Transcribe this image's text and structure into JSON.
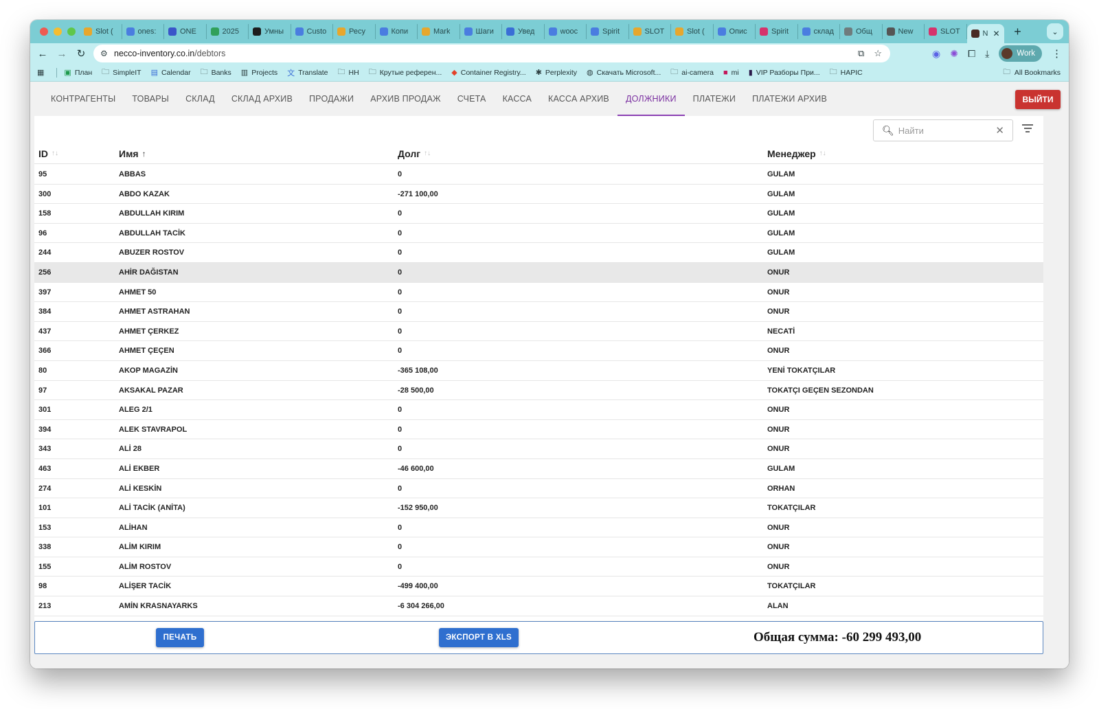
{
  "browser": {
    "tabs": [
      {
        "label": "Slot (",
        "color": "#e7a72d"
      },
      {
        "label": "ones:",
        "color": "#4a7de0"
      },
      {
        "label": "ONE",
        "color": "#3a55c9"
      },
      {
        "label": "2025",
        "color": "#31a05a"
      },
      {
        "label": "Умны",
        "color": "#1d1d1d"
      },
      {
        "label": "Custo",
        "color": "#4a7de0"
      },
      {
        "label": "Ресу",
        "color": "#e7a72d"
      },
      {
        "label": "Копи",
        "color": "#4a7de0"
      },
      {
        "label": "Mark",
        "color": "#e7a72d"
      },
      {
        "label": "Шаги",
        "color": "#4a7de0"
      },
      {
        "label": "Увед",
        "color": "#3a6ed6"
      },
      {
        "label": "wooc",
        "color": "#4a7de0"
      },
      {
        "label": "Spirit",
        "color": "#4a7de0"
      },
      {
        "label": "SLOT",
        "color": "#e7a72d"
      },
      {
        "label": "Slot (",
        "color": "#e7a72d"
      },
      {
        "label": "Опис",
        "color": "#4a7de0"
      },
      {
        "label": "Spirit",
        "color": "#d6336c"
      },
      {
        "label": "склад",
        "color": "#4a7de0"
      },
      {
        "label": "Общ",
        "color": "#6f7c7d"
      },
      {
        "label": "New",
        "color": "#555555"
      },
      {
        "label": "SLOT",
        "color": "#d6336c"
      }
    ],
    "active_tab": {
      "label": "N",
      "close": "✕"
    },
    "new_tab": "+",
    "url_host": "necco-inventory.co.in",
    "url_path": "/debtors",
    "profile": "Work",
    "bookmarks": [
      {
        "label": "План",
        "icon": "sheets-icon"
      },
      {
        "label": "SimpleIT",
        "icon": "folder-icon"
      },
      {
        "label": "Calendar",
        "icon": "calendar-icon"
      },
      {
        "label": "Banks",
        "icon": "folder-icon"
      },
      {
        "label": "Projects",
        "icon": "projects-icon"
      },
      {
        "label": "Translate",
        "icon": "translate-icon"
      },
      {
        "label": "HH",
        "icon": "folder-icon"
      },
      {
        "label": "Крутые референ...",
        "icon": "folder-icon"
      },
      {
        "label": "Container Registry...",
        "icon": "gitlab-icon"
      },
      {
        "label": "Perplexity",
        "icon": "perplexity-icon"
      },
      {
        "label": "Скачать Microsoft...",
        "icon": "download-icon"
      },
      {
        "label": "ai-camera",
        "icon": "folder-icon"
      },
      {
        "label": "mi",
        "icon": "mi-icon"
      },
      {
        "label": "VIP Разборы При...",
        "icon": "vip-icon"
      },
      {
        "label": "HAPIC",
        "icon": "folder-icon"
      }
    ],
    "all_bookmarks": "All Bookmarks"
  },
  "nav": {
    "items": [
      "КОНТРАГЕНТЫ",
      "ТОВАРЫ",
      "СКЛАД",
      "СКЛАД АРХИВ",
      "ПРОДАЖИ",
      "АРХИВ ПРОДАЖ",
      "СЧЕТА",
      "КАССА",
      "КАССА АРХИВ",
      "ДОЛЖНИКИ",
      "ПЛАТЕЖИ",
      "ПЛАТЕЖИ АРХИВ"
    ],
    "active_index": 9,
    "logout": "ВЫЙТИ"
  },
  "search": {
    "placeholder": "Найти"
  },
  "table": {
    "columns": [
      "ID",
      "Имя",
      "Долг",
      "Менеджер"
    ],
    "sorted_column": "Имя",
    "rows": [
      [
        "95",
        "ABBAS",
        "0",
        "GULAM"
      ],
      [
        "300",
        "ABDO KAZAK",
        "-271 100,00",
        "GULAM"
      ],
      [
        "158",
        "ABDULLAH KIRIM",
        "0",
        "GULAM"
      ],
      [
        "96",
        "ABDULLAH TACİK",
        "0",
        "GULAM"
      ],
      [
        "244",
        "ABUZER ROSTOV",
        "0",
        "GULAM"
      ],
      [
        "256",
        "AHİR DAĞISTAN",
        "0",
        "ONUR"
      ],
      [
        "397",
        "AHMET 50",
        "0",
        "ONUR"
      ],
      [
        "384",
        "AHMET ASTRAHAN",
        "0",
        "ONUR"
      ],
      [
        "437",
        "AHMET ÇERKEZ",
        "0",
        "NECATİ"
      ],
      [
        "366",
        "AHMET ÇEÇEN",
        "0",
        "ONUR"
      ],
      [
        "80",
        "AKOP MAGAZİN",
        "-365 108,00",
        "YENİ TOKATÇILAR"
      ],
      [
        "97",
        "AKSAKAL PAZAR",
        "-28 500,00",
        "TOKATÇI GEÇEN SEZONDAN"
      ],
      [
        "301",
        "ALEG 2/1",
        "0",
        "ONUR"
      ],
      [
        "394",
        "ALEK STAVRAPOL",
        "0",
        "ONUR"
      ],
      [
        "343",
        "ALİ 28",
        "0",
        "ONUR"
      ],
      [
        "463",
        "ALİ EKBER",
        "-46 600,00",
        "GULAM"
      ],
      [
        "274",
        "ALİ KESKİN",
        "0",
        "ORHAN"
      ],
      [
        "101",
        "ALİ TACİK (ANİTA)",
        "-152 950,00",
        "TOKATÇILAR"
      ],
      [
        "153",
        "ALİHAN",
        "0",
        "ONUR"
      ],
      [
        "338",
        "ALİM KIRIM",
        "0",
        "ONUR"
      ],
      [
        "155",
        "ALİM ROSTOV",
        "0",
        "ONUR"
      ],
      [
        "98",
        "ALİŞER TACİK",
        "-499 400,00",
        "TOKATÇILAR"
      ],
      [
        "213",
        "AMİN KRASNAYARKS",
        "-6 304 266,00",
        "ALAN"
      ]
    ],
    "highlighted_row": 5
  },
  "footer": {
    "print": "ПЕЧАТЬ",
    "export": "ЭКСПОРТ В XLS",
    "total": "Общая сумма: -60 299 493,00"
  }
}
